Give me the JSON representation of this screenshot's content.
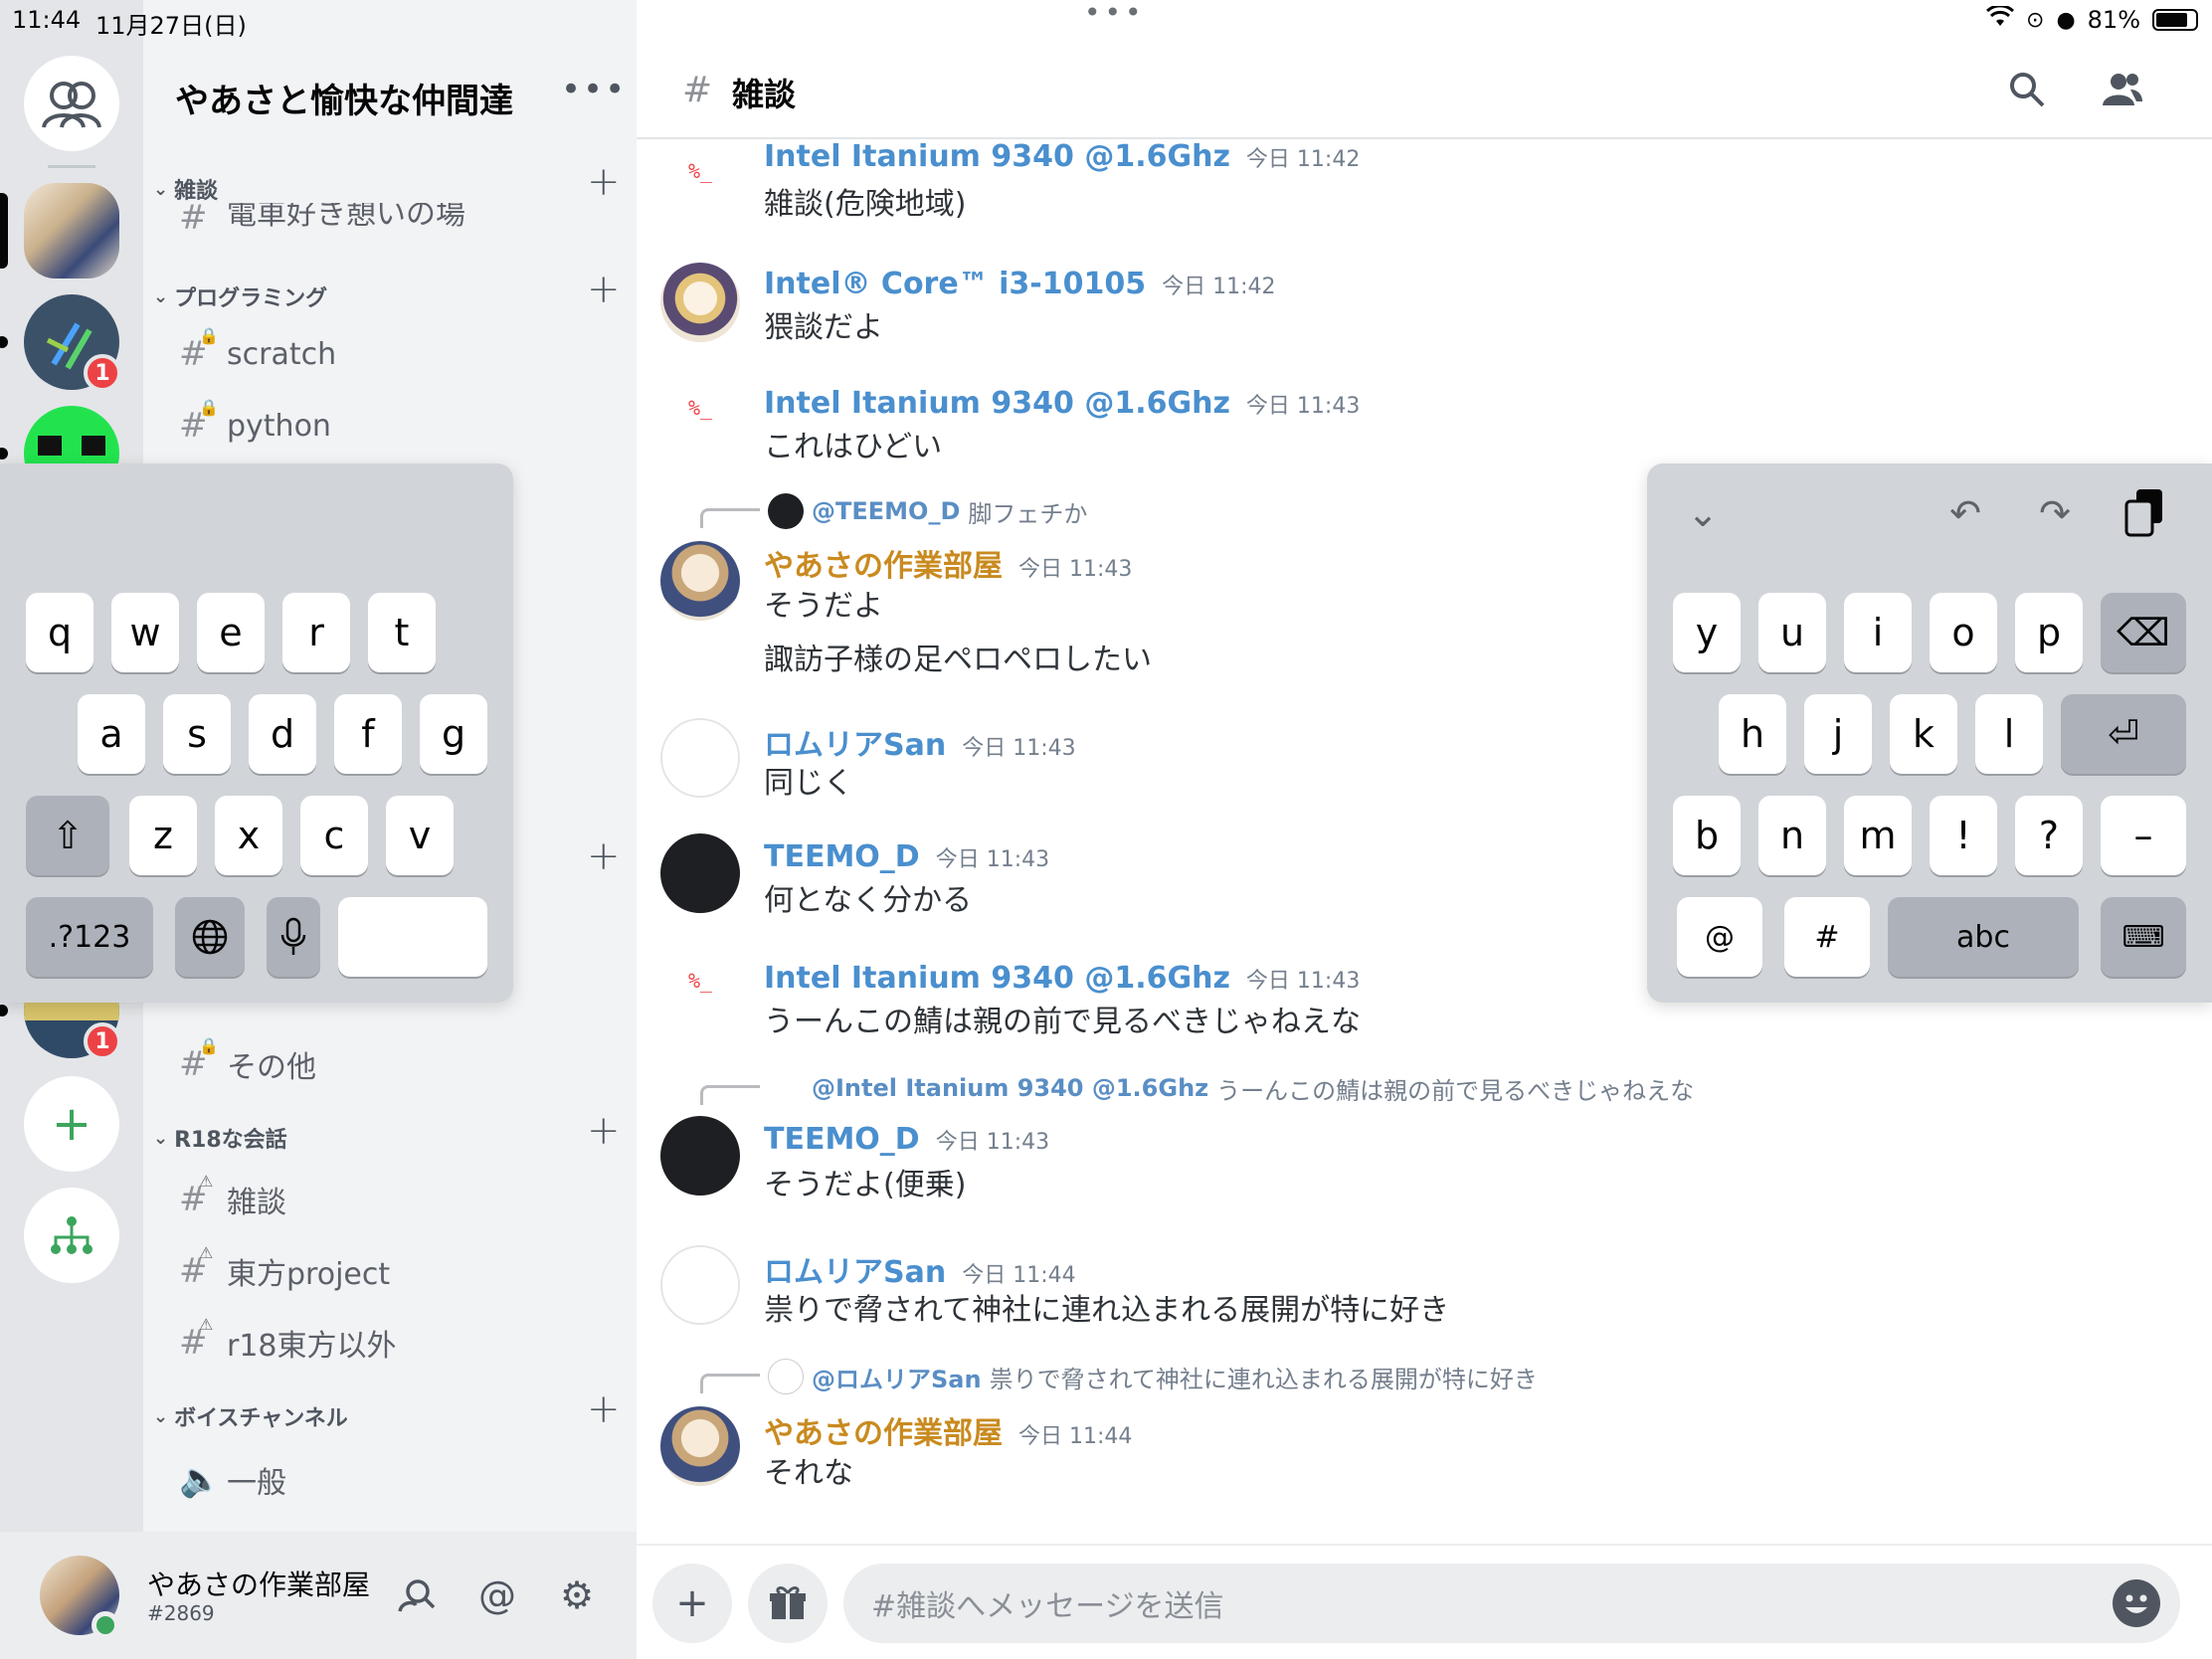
{
  "status_bar": {
    "time": "11:44",
    "date": "11月27日(日)",
    "battery": "81%",
    "battery_fraction": 0.81,
    "multitask_dots": "•••"
  },
  "servers": {
    "badges": [
      "1",
      "1"
    ],
    "add_glyph": "+",
    "discover_glyph": "⚘"
  },
  "guild": {
    "name": "やあさと愉快な仲間達",
    "more": "•••"
  },
  "categories": [
    {
      "name": "雑談"
    },
    {
      "name": "プログラミング"
    },
    {
      "name": "R18な会話"
    },
    {
      "name": "ボイスチャンネル"
    }
  ],
  "channels": {
    "partial_top": "電車好き憩いの場",
    "scratch": "scratch",
    "python": "python",
    "other": "その他",
    "r18_chat": "雑談",
    "r18_touhou": "東方project",
    "r18_other": "r18東方以外",
    "voice_general": "一般"
  },
  "user_panel": {
    "name": "やあさの作業部屋",
    "tag": "#2869"
  },
  "chat": {
    "channel_name": "雑談"
  },
  "messages": [
    {
      "author": "Intel Itanium 9340 @1.6Ghz",
      "time": "今日 11:42",
      "text": "雑談(危険地域)",
      "avatar_text": "%_"
    },
    {
      "author": "Intel® Core™ i3-10105",
      "time": "今日 11:42",
      "text": "猥談だよ"
    },
    {
      "author": "Intel Itanium 9340 @1.6Ghz",
      "time": "今日 11:43",
      "text": "これはひどい",
      "avatar_text": "%_"
    },
    {
      "reply_author": "@TEEMO_D",
      "reply_text": "脚フェチか",
      "author": "やあさの作業部屋",
      "time": "今日 11:43",
      "text": "そうだよ",
      "text2": "諏訪子様の足ペロペロしたい"
    },
    {
      "author": "ロムリアSan",
      "time": "今日 11:43",
      "text": "同じく"
    },
    {
      "author": "TEEMO_D",
      "time": "今日 11:43",
      "text": "何となく分かる"
    },
    {
      "author": "Intel Itanium 9340 @1.6Ghz",
      "time": "今日 11:43",
      "text": "うーんこの鯖は親の前で見るべきじゃねえな",
      "avatar_text": "%_"
    },
    {
      "reply_author": "@Intel Itanium 9340 @1.6Ghz",
      "reply_text": "うーんこの鯖は親の前で見るべきじゃねえな",
      "author": "TEEMO_D",
      "time": "今日 11:43",
      "text": "そうだよ(便乗)"
    },
    {
      "author": "ロムリアSan",
      "time": "今日 11:44",
      "text": "祟りで脅されて神社に連れ込まれる展開が特に好き"
    },
    {
      "reply_author": "@ロムリアSan",
      "reply_text": "祟りで脅されて神社に連れ込まれる展開が特に好き",
      "author": "やあさの作業部屋",
      "time": "今日 11:44",
      "text": "それな"
    }
  ],
  "composer": {
    "placeholder": "#雑談へメッセージを送信"
  },
  "keyboard_left": {
    "row1": [
      "q",
      "w",
      "e",
      "r",
      "t"
    ],
    "row2": [
      "a",
      "s",
      "d",
      "f",
      "g"
    ],
    "row3": [
      "z",
      "x",
      "c",
      "v"
    ],
    "shift": "⇧",
    "numbers": ".?123",
    "globe": "🌐",
    "mic": "🎙"
  },
  "keyboard_right": {
    "row1": [
      "y",
      "u",
      "i",
      "o",
      "p"
    ],
    "row2": [
      "h",
      "j",
      "k",
      "l"
    ],
    "row3": [
      "b",
      "n",
      "m",
      "!",
      "?",
      "–"
    ],
    "row4": [
      "@",
      "#",
      "abc"
    ],
    "delete": "⌫",
    "return": "⏎",
    "hide": "⌨",
    "collapse": "⌄",
    "undo": "↶",
    "redo": "↷",
    "paste": "📋"
  }
}
